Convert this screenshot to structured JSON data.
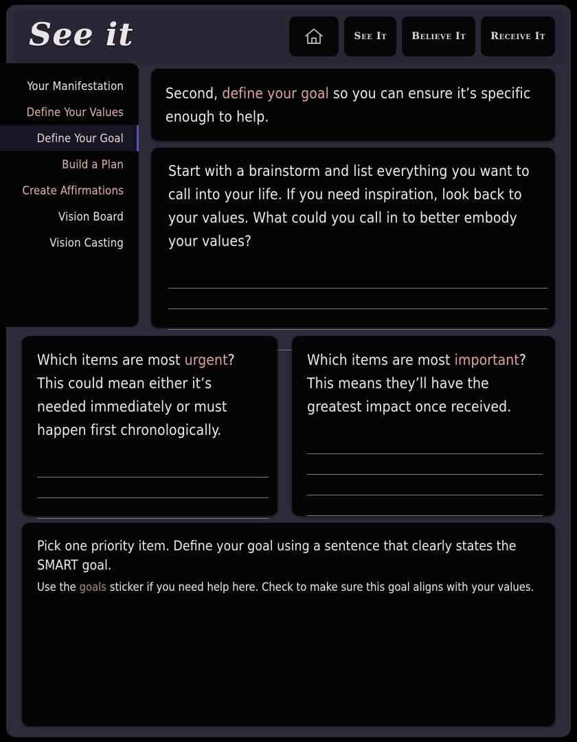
{
  "brand": {
    "logo_text": "See it"
  },
  "accent_colors": {
    "highlight": "#e0a49c",
    "highlight_dim": "#b08782",
    "active_marker": "#5b54a8",
    "card_bg": "#050506",
    "frame_bg": "#2b2b39"
  },
  "header": {
    "nav": [
      {
        "label": "",
        "icon": "home-icon",
        "name": "nav-home"
      },
      {
        "label": "See It",
        "icon": "",
        "name": "nav-see-it"
      },
      {
        "label": "Believe It",
        "icon": "",
        "name": "nav-believe-it"
      },
      {
        "label": "Receive It",
        "icon": "",
        "name": "nav-receive-it"
      }
    ]
  },
  "sidebar": {
    "items": [
      {
        "label": "Your Manifestation",
        "style": "plain",
        "active": false
      },
      {
        "label": "Define Your Values",
        "style": "accent",
        "active": false
      },
      {
        "label": "Define Your Goal",
        "style": "accent",
        "active": true
      },
      {
        "label": "Build a Plan",
        "style": "accent",
        "active": false
      },
      {
        "label": "Create Affirmations",
        "style": "accent",
        "active": false
      },
      {
        "label": "Vision Board",
        "style": "plain",
        "active": false
      },
      {
        "label": "Vision Casting",
        "style": "plain",
        "active": false
      }
    ]
  },
  "main": {
    "intro": {
      "pre": "Second, ",
      "highlight": "define your goal",
      "post": " so you can ensure it’s specific enough to help."
    },
    "brainstorm": {
      "text": "Start with a brainstorm and list everything you want to call into your life. If you need inspiration, look back to your values. What could you call in to better embody your values?",
      "line_count": 4
    },
    "urgent": {
      "pre": "Which items are most ",
      "highlight": "urgent",
      "post": "? This could mean either it’s needed immediately or must happen first chronologically.",
      "line_count": 4
    },
    "important": {
      "pre": "Which items are most ",
      "highlight": "important",
      "post": "? This means they’ll have the greatest impact once received.",
      "line_count": 4
    },
    "smart": {
      "line1": "Pick one priority item. Define your goal using a sentence that clearly states the SMART goal.",
      "line2_pre": "Use the ",
      "line2_highlight": "goals",
      "line2_post": " sticker if you need help here. Check to make sure this goal aligns with your values."
    }
  }
}
